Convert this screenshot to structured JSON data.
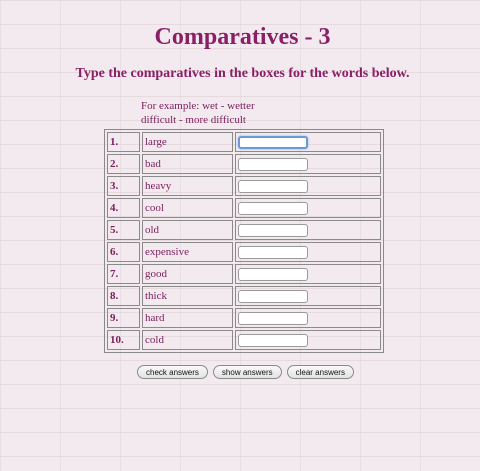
{
  "title": "Comparatives - 3",
  "instruction": "Type the comparatives in the boxes for the words below.",
  "example": {
    "line1": "For example: wet - wetter",
    "line2": "difficult - more difficult"
  },
  "rows": [
    {
      "num": "1.",
      "word": "large",
      "answer": ""
    },
    {
      "num": "2.",
      "word": "bad",
      "answer": ""
    },
    {
      "num": "3.",
      "word": "heavy",
      "answer": ""
    },
    {
      "num": "4.",
      "word": "cool",
      "answer": ""
    },
    {
      "num": "5.",
      "word": "old",
      "answer": ""
    },
    {
      "num": "6.",
      "word": "expensive",
      "answer": ""
    },
    {
      "num": "7.",
      "word": "good",
      "answer": ""
    },
    {
      "num": "8.",
      "word": "thick",
      "answer": ""
    },
    {
      "num": "9.",
      "word": "hard",
      "answer": ""
    },
    {
      "num": "10.",
      "word": "cold",
      "answer": ""
    }
  ],
  "buttons": {
    "check": "check answers",
    "show": "show answers",
    "clear": "clear answers"
  },
  "colors": {
    "heading": "#8a1f66",
    "text": "#7a1d5b",
    "background": "#f3eaef",
    "focus_ring": "#6b9ad6"
  }
}
